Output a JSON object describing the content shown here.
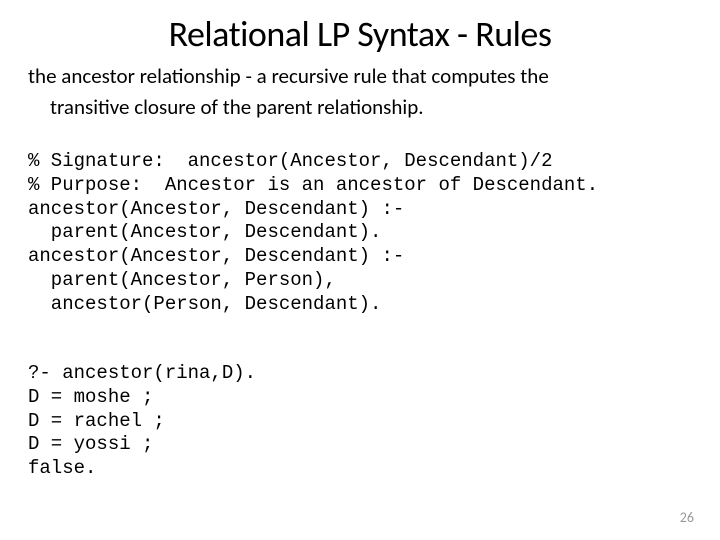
{
  "title": "Relational LP Syntax - Rules",
  "subtitle_line1": "the ancestor relationship - a recursive rule that computes the",
  "subtitle_line2": "transitive closure of the parent relationship.",
  "code": {
    "l1": "% Signature:  ancestor(Ancestor, Descendant)/2",
    "l2": "% Purpose:  Ancestor is an ancestor of Descendant.",
    "l3": "ancestor(Ancestor, Descendant) :-",
    "l4": "  parent(Ancestor, Descendant).",
    "l5": "ancestor(Ancestor, Descendant) :-",
    "l6": "  parent(Ancestor, Person),",
    "l7": "  ancestor(Person, Descendant)."
  },
  "query": {
    "q1": "?- ancestor(rina,D).",
    "q2": "D = moshe ;",
    "q3": "D = rachel ;",
    "q4": "D = yossi ;",
    "q5": "false."
  },
  "page_number": "26"
}
